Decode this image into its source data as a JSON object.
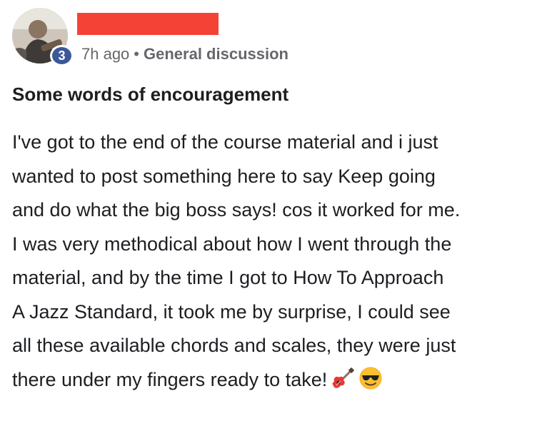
{
  "post": {
    "level_badge": "3",
    "time": "7h ago",
    "separator": "•",
    "group": "General discussion",
    "title": "Some words of encouragement",
    "body_lines": [
      "I've got to the end of the course material and i just",
      "wanted to post something here to say Keep going",
      "and do what the big boss says! cos it worked for me.",
      "I was very methodical about how I went through the",
      "material, and by the time I got to How To Approach",
      "A Jazz Standard, it took me by surprise, I could see",
      "all these available chords and scales, they were just",
      "there under my fingers ready to take!"
    ],
    "emojis": [
      "guitar-emoji",
      "sunglasses-emoji"
    ]
  },
  "colors": {
    "badge": "#3b5998",
    "redaction": "#f44336",
    "meta_text": "#65676b",
    "text": "#1c1e21"
  }
}
